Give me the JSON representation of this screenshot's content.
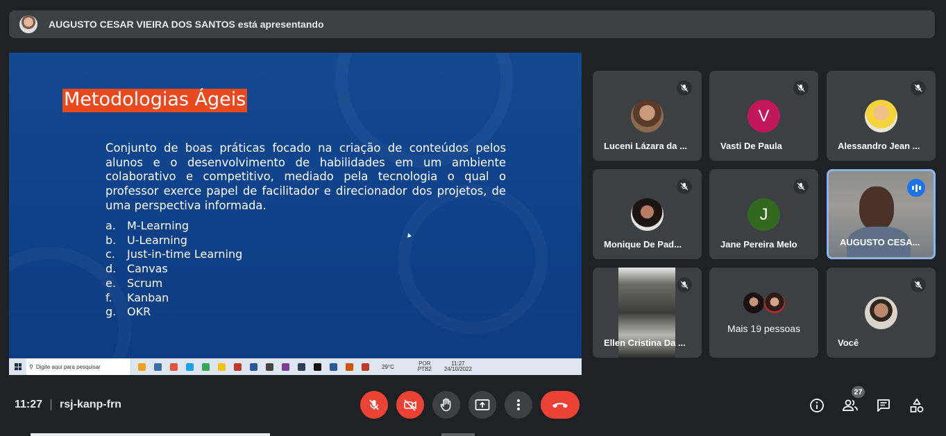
{
  "banner": {
    "presenter_text": "AUGUSTO CESAR VIEIRA DOS SANTOS está apresentando"
  },
  "slide": {
    "title": "Metodologias Ágeis",
    "paragraph": "Conjunto de boas práticas focado na criação de conteúdos pelos alunos e o desenvolvimento de habilidades em um ambiente colaborativo e competitivo, mediado pela tecnologia o qual o professor exerce papel de facilitador e direcionador dos projetos, de uma perspectiva informada.",
    "list": [
      {
        "letter": "a.",
        "text": "M-Learning"
      },
      {
        "letter": "b.",
        "text": "U-Learning"
      },
      {
        "letter": "c.",
        "text": "Just-in-time Learning"
      },
      {
        "letter": "d.",
        "text": "Canvas"
      },
      {
        "letter": "e.",
        "text": "Scrum"
      },
      {
        "letter": "f.",
        "text": "Kanban"
      },
      {
        "letter": "g.",
        "text": "OKR"
      }
    ],
    "taskbar": {
      "search_placeholder": "Digite aqui para pesquisar",
      "weather": "29°C",
      "lang1": "POR",
      "lang2": "PTB2",
      "time": "11:27",
      "date": "24/10/2022"
    }
  },
  "participants": [
    {
      "name": "Luceni Lázara da ...",
      "avatar": "photo",
      "muted": true
    },
    {
      "name": "Vasti De Paula",
      "avatar": "V",
      "avatar_color": "#c2185b",
      "muted": true
    },
    {
      "name": "Alessandro Jean ...",
      "avatar": "photo",
      "muted": true
    },
    {
      "name": "Monique De Pad...",
      "avatar": "photo",
      "muted": true
    },
    {
      "name": "Jane Pereira Melo",
      "avatar": "J",
      "avatar_color": "#33691e",
      "muted": true
    },
    {
      "name": "AUGUSTO CESA...",
      "avatar": "video",
      "speaking": true
    },
    {
      "name": "Ellen Cristina Da ...",
      "avatar": "video",
      "muted": true
    },
    {
      "name": "Mais 19 pessoas",
      "avatar": "group"
    },
    {
      "name": "Você",
      "avatar": "photo",
      "muted": true
    }
  ],
  "bottom_bar": {
    "time": "11:27",
    "meeting_code": "rsj-kanp-frn",
    "people_count": "27"
  },
  "colors": {
    "accent_red": "#ea4335",
    "slide_title_bg": "#e8491f",
    "active_border": "#8ab4f8"
  }
}
